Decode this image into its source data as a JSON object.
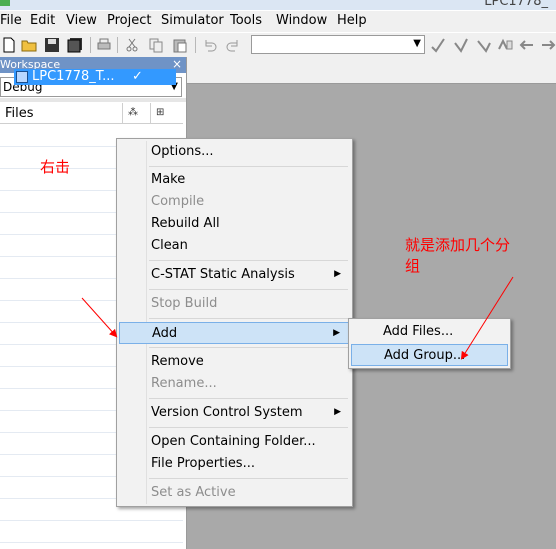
{
  "window": {
    "title": "LPC1778_"
  },
  "menubar": {
    "items": [
      "File",
      "Edit",
      "View",
      "Project",
      "Simulator",
      "Tools",
      "Window",
      "Help"
    ]
  },
  "workspace": {
    "header": "Workspace",
    "close_label": "×",
    "config": "Debug",
    "files_label": "Files",
    "project_name": "LPC1778_T...",
    "project_check": "✓"
  },
  "annotations": {
    "right_click": "右击",
    "add_group_note_line1": "就是添加几个分",
    "add_group_note_line2": "组"
  },
  "context_menu": {
    "items": [
      {
        "label": "Options...",
        "disabled": false,
        "submenu": false
      },
      {
        "label": "Make",
        "disabled": false,
        "submenu": false
      },
      {
        "label": "Compile",
        "disabled": true,
        "submenu": false
      },
      {
        "label": "Rebuild All",
        "disabled": false,
        "submenu": false
      },
      {
        "label": "Clean",
        "disabled": false,
        "submenu": false
      },
      {
        "label": "C-STAT Static Analysis",
        "disabled": false,
        "submenu": true
      },
      {
        "label": "Stop Build",
        "disabled": true,
        "submenu": false
      },
      {
        "label": "Add",
        "disabled": false,
        "submenu": true,
        "highlighted": true
      },
      {
        "label": "Remove",
        "disabled": false,
        "submenu": false
      },
      {
        "label": "Rename...",
        "disabled": true,
        "submenu": false
      },
      {
        "label": "Version Control System",
        "disabled": false,
        "submenu": true
      },
      {
        "label": "Open Containing Folder...",
        "disabled": false,
        "submenu": false
      },
      {
        "label": "File Properties...",
        "disabled": false,
        "submenu": false
      },
      {
        "label": "Set as Active",
        "disabled": true,
        "submenu": false
      }
    ],
    "submenu_arrow": "▶"
  },
  "add_submenu": {
    "items": [
      {
        "label": "Add Files...",
        "highlighted": false
      },
      {
        "label": "Add Group...",
        "highlighted": true
      }
    ]
  },
  "colors": {
    "selection": "#3399ff",
    "menu_highlight": "#cde3f7",
    "annotation": "#ff0000",
    "editor_bg": "#a9a9a9"
  }
}
